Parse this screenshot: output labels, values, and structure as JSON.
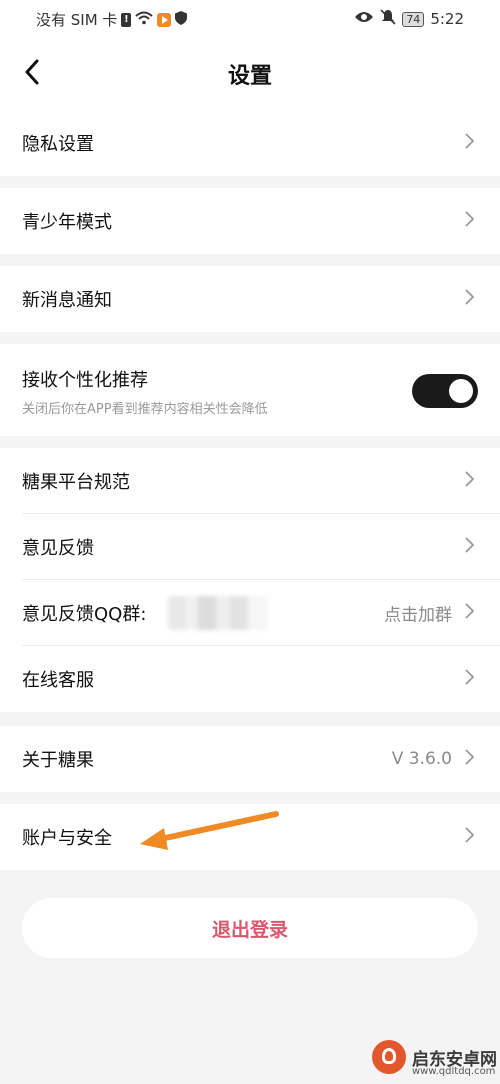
{
  "status_bar": {
    "carrier": "没有 SIM 卡",
    "battery": "74",
    "time": "5:22"
  },
  "header": {
    "title": "设置"
  },
  "groups": {
    "privacy": {
      "label": "隐私设置"
    },
    "youth": {
      "label": "青少年模式"
    },
    "notify": {
      "label": "新消息通知"
    },
    "personalize": {
      "label": "接收个性化推荐",
      "description": "关闭后你在APP看到推荐内容相关性会降低",
      "enabled": true
    },
    "info": {
      "platform_rules": "糖果平台规范",
      "feedback": "意见反馈",
      "qq_group_label": "意见反馈QQ群:",
      "qq_group_action": "点击加群",
      "online_service": "在线客服"
    },
    "about": {
      "label": "关于糖果",
      "version": "V 3.6.0"
    },
    "account": {
      "label": "账户与安全"
    }
  },
  "logout": {
    "label": "退出登录"
  },
  "watermark": {
    "name": "启东安卓网",
    "url": "www.qdltdq.com"
  },
  "colors": {
    "accent": "#d9586e",
    "annotation": "#f08a24",
    "toggle_on": "#1a1a1a"
  }
}
